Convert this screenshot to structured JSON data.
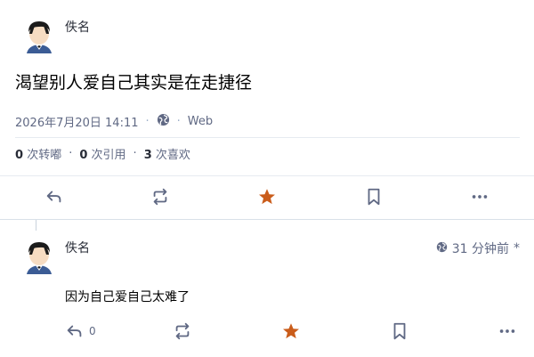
{
  "status": {
    "author_name": "佚名",
    "content": "渴望别人爱自己其实是在走捷径",
    "timestamp": "2026年7月20日 14:11",
    "visibility_icon": "globe-icon",
    "application": "Web",
    "stats": {
      "reblogs_count": "0",
      "reblogs_label": "次转嘟",
      "quotes_count": "0",
      "quotes_label": "次引用",
      "favourites_count": "3",
      "favourites_label": "次喜欢"
    }
  },
  "reply": {
    "author_name": "佚名",
    "relative_time": "31 分钟前",
    "edited_marker": "*",
    "content": "因为自己爱自己太难了",
    "reply_count": "0"
  },
  "colors": {
    "favourite_active": "#ca5d1b",
    "icon": "#606984",
    "border": "#d9e1e8"
  }
}
